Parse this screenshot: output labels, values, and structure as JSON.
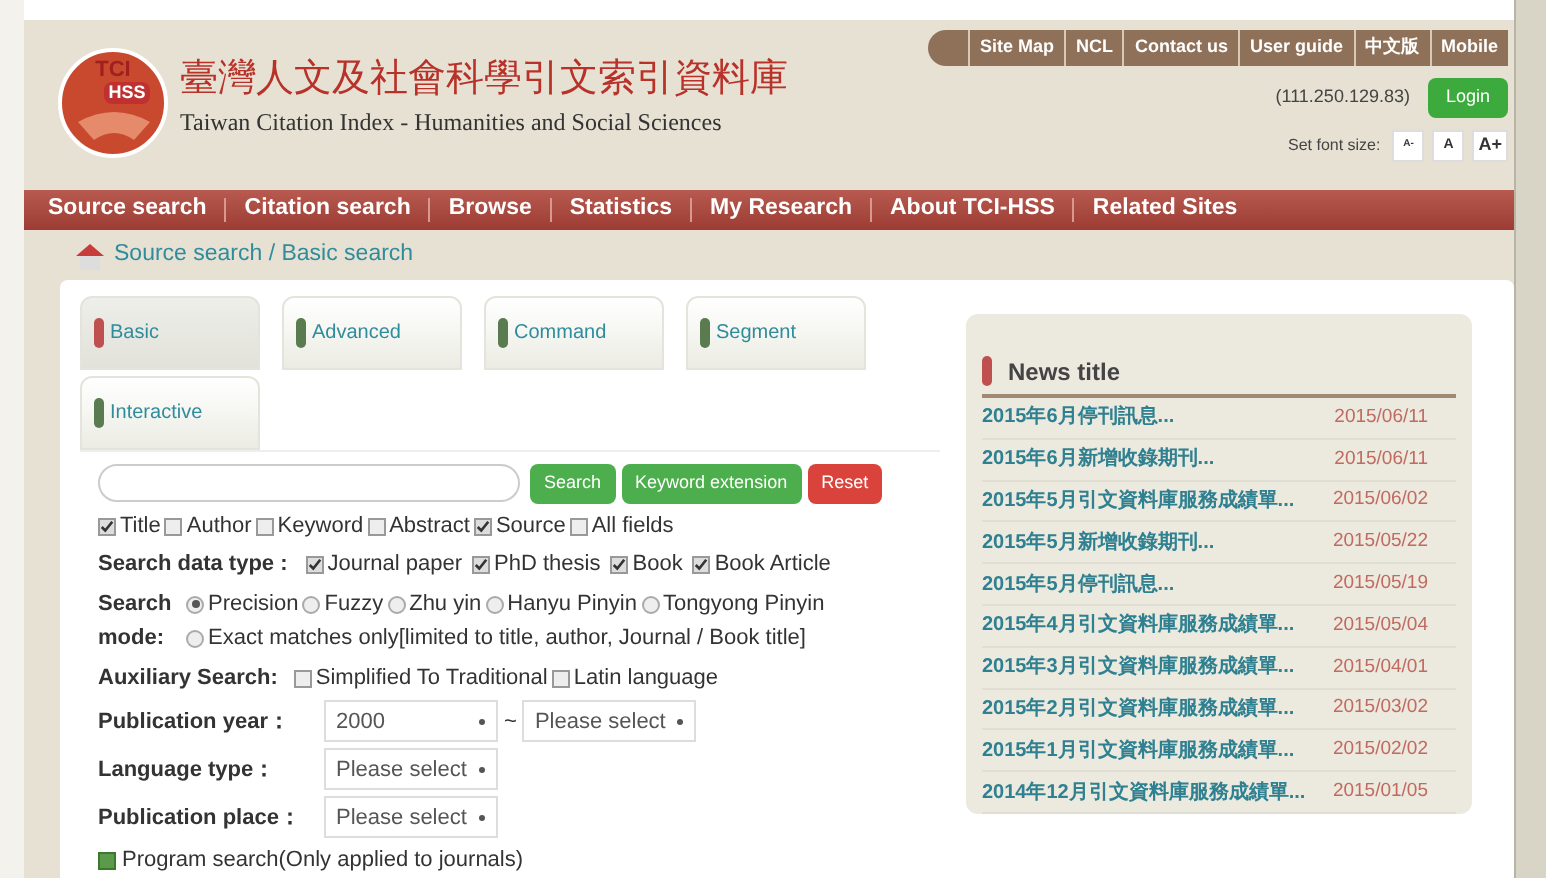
{
  "header": {
    "logo_top": "TCI",
    "logo_badge": "HSS",
    "title": "臺灣人文及社會科學引文索引資料庫",
    "subtitle": "Taiwan Citation Index - Humanities and Social Sciences"
  },
  "top_links": [
    "Site Map",
    "NCL",
    "Contact us",
    "User guide",
    "中文版",
    "Mobile"
  ],
  "ip": "(111.250.129.83)",
  "login": "Login",
  "font_size": {
    "label": "Set font size:",
    "buttons": [
      "A-",
      "A",
      "A+"
    ]
  },
  "nav": [
    "Source search",
    "Citation search",
    "Browse",
    "Statistics",
    "My Research",
    "About TCI-HSS",
    "Related Sites"
  ],
  "breadcrumb": "Source search / Basic search",
  "tabs": [
    {
      "label": "Basic",
      "selected": true
    },
    {
      "label": "Advanced",
      "selected": false
    },
    {
      "label": "Command",
      "selected": false
    },
    {
      "label": "Segment",
      "selected": false
    },
    {
      "label": "Interactive",
      "selected": false
    }
  ],
  "search_buttons": [
    {
      "label": "Search",
      "kind": "primary"
    },
    {
      "label": "Keyword extension",
      "kind": "primary"
    },
    {
      "label": "Reset",
      "kind": "danger"
    }
  ],
  "fields": [
    {
      "label": "Title",
      "checked": true
    },
    {
      "label": "Author",
      "checked": false
    },
    {
      "label": "Keyword",
      "checked": false
    },
    {
      "label": "Abstract",
      "checked": false
    },
    {
      "label": "Source",
      "checked": true
    },
    {
      "label": "All fields",
      "checked": false
    }
  ],
  "data_type": {
    "label": "Search data type :",
    "options": [
      {
        "label": "Journal paper",
        "checked": true
      },
      {
        "label": "PhD thesis",
        "checked": true
      },
      {
        "label": "Book",
        "checked": true
      },
      {
        "label": "Book Article",
        "checked": true
      }
    ]
  },
  "search_mode": {
    "label": "Search mode:",
    "options": [
      {
        "label": "Precision",
        "selected": true
      },
      {
        "label": "Fuzzy",
        "selected": false
      },
      {
        "label": "Zhu yin",
        "selected": false
      },
      {
        "label": "Hanyu Pinyin",
        "selected": false
      },
      {
        "label": "Tongyong Pinyin",
        "selected": false
      },
      {
        "label": "Exact matches only[limited to title, author, Journal / Book title]",
        "selected": false
      }
    ]
  },
  "auxiliary": {
    "label": "Auxiliary Search:",
    "options": [
      {
        "label": "Simplified To Traditional",
        "checked": false
      },
      {
        "label": "Latin language",
        "checked": false
      }
    ]
  },
  "publication_year": {
    "label": "Publication year：",
    "from": "2000",
    "separator": "~",
    "to": "Please select"
  },
  "language_type": {
    "label": "Language type：",
    "value": "Please select"
  },
  "publication_place": {
    "label": "Publication place：",
    "value": "Please select"
  },
  "program_search": "Program search(Only applied to journals)",
  "news": {
    "title": "News title",
    "items": [
      {
        "title": "2015年6月停刊訊息...",
        "date": "2015/06/11"
      },
      {
        "title": "2015年6月新增收錄期刊...",
        "date": "2015/06/11"
      },
      {
        "title": "2015年5月引文資料庫服務成績單...",
        "date": "2015/06/02"
      },
      {
        "title": "2015年5月新增收錄期刊...",
        "date": "2015/05/22"
      },
      {
        "title": "2015年5月停刊訊息...",
        "date": "2015/05/19"
      },
      {
        "title": "2015年4月引文資料庫服務成績單...",
        "date": "2015/05/04"
      },
      {
        "title": "2015年3月引文資料庫服務成績單...",
        "date": "2015/04/01"
      },
      {
        "title": "2015年2月引文資料庫服務成績單...",
        "date": "2015/03/02"
      },
      {
        "title": "2015年1月引文資料庫服務成績單...",
        "date": "2015/02/02"
      },
      {
        "title": "2014年12月引文資料庫服務成績單...",
        "date": "2015/01/05"
      }
    ]
  }
}
